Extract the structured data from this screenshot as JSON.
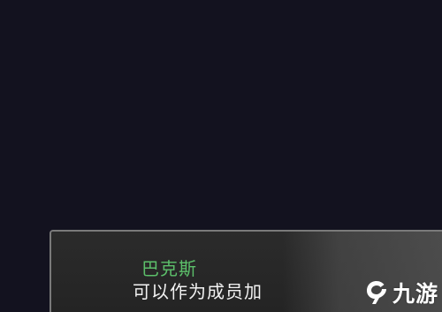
{
  "dialog": {
    "speaker": "巴克斯",
    "text": "可以作为成员加"
  },
  "watermark": {
    "text": "九游",
    "icon": "jiuyou-logo-icon"
  },
  "colors": {
    "background": "#13121f",
    "dialog_bg": "#262626",
    "dialog_border": "#7a7a7a",
    "speaker_name": "#5cbf6a",
    "dialog_text": "#f2f2f2"
  }
}
